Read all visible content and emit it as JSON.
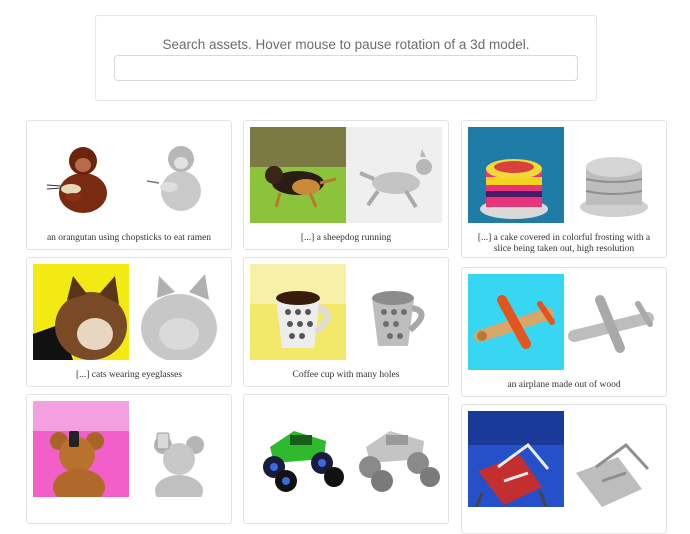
{
  "search": {
    "prompt": "Search assets. Hover mouse to pause rotation of a 3d model.",
    "value": "",
    "placeholder": ""
  },
  "cards": [
    {
      "caption": "an orangutan using chopsticks to eat ramen",
      "icon": "orangutan-icon"
    },
    {
      "caption": "[...] a sheepdog running",
      "icon": "dog-icon"
    },
    {
      "caption": "[...] a cake covered in colorful frosting with a slice being taken out, high resolution",
      "icon": "cake-icon"
    },
    {
      "caption": "[...] cats wearing eyeglasses",
      "icon": "cat-icon"
    },
    {
      "caption": "Coffee cup with many holes",
      "icon": "cup-icon"
    },
    {
      "caption": "an airplane made out of wood",
      "icon": "airplane-icon"
    },
    {
      "caption": "",
      "icon": "teddy-bear-icon"
    },
    {
      "caption": "",
      "icon": "monster-truck-icon"
    },
    {
      "caption": "",
      "icon": "chair-icon"
    }
  ],
  "colors": {
    "dog_bg": "#86c23a",
    "cake_bg": "#1f7fa8",
    "cat_bg": "#f4ea13",
    "cup_bg": "#f2e86a",
    "plane_bg": "#37d6f2",
    "teddy_bg": "#f25fc8",
    "truck_bg": "#ffffff",
    "chair_bg": "#2650c9"
  }
}
